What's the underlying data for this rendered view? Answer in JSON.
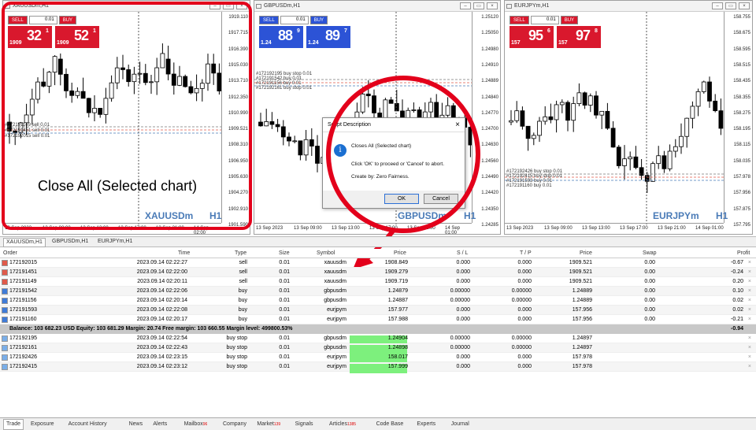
{
  "colors": {
    "sell": "#d9182d",
    "buy": "#2c53d6",
    "accent": "#e3001b",
    "bull": "#ffffff",
    "bear": "#000000",
    "pending_highlight": "#7df07d"
  },
  "charts": [
    {
      "title": "XAUUSDm,H1",
      "symbol": "XAUUSDm",
      "timeframe": "H1",
      "sell_label": "SELL",
      "buy_label": "BUY",
      "lot": "0.01",
      "sell_small": "1909",
      "sell_big": "32",
      "sell_sup": "1",
      "buy_small": "1909",
      "buy_big": "52",
      "buy_sup": "1",
      "price_ticks": [
        "1919.110",
        "1917.715",
        "1916.390",
        "1915.030",
        "1913.710",
        "1912.350",
        "1910.990",
        "1909.521",
        "1908.310",
        "1906.950",
        "1905.630",
        "1904.270",
        "1902.910",
        "1901.590"
      ],
      "time_ticks": [
        "13 Sep 2023",
        "13 Sep 08:00",
        "13 Sep 13:00",
        "13 Sep 17:00",
        "13 Sep 21:00",
        "14 Sep 02:00"
      ],
      "order_lines": [
        "#172191149 sell 0.01",
        "#172191451 sell 0.01",
        "#172192015 sell 0.01"
      ]
    },
    {
      "title": "GBPUSDm,H1",
      "symbol": "GBPUSDm",
      "timeframe": "H1",
      "sell_label": "SELL",
      "buy_label": "BUY",
      "lot": "0.01",
      "sell_small": "1.24",
      "sell_big": "88",
      "sell_sup": "9",
      "buy_small": "1.24",
      "buy_big": "89",
      "buy_sup": "7",
      "price_ticks": [
        "1.25120",
        "1.25050",
        "1.24980",
        "1.24910",
        "1.24889",
        "1.24840",
        "1.24770",
        "1.24700",
        "1.24630",
        "1.24560",
        "1.24490",
        "1.24420",
        "1.24350",
        "1.24285"
      ],
      "time_ticks": [
        "13 Sep 2023",
        "13 Sep 09:00",
        "13 Sep 13:00",
        "13 Sep 17:00",
        "13 Sep 21:00",
        "14 Sep 01:00"
      ],
      "order_lines": [
        "#172192195 buy stop 0.01",
        "#172191542 buy 0.01",
        "#172191156 buy 0.01",
        "#172192161 buy stop 0.01"
      ]
    },
    {
      "title": "EURJPYm,H1",
      "symbol": "EURJPYm",
      "timeframe": "H1",
      "sell_label": "SELL",
      "buy_label": "BUY",
      "lot": "0.01",
      "sell_small": "157",
      "sell_big": "95",
      "sell_sup": "6",
      "buy_small": "157",
      "buy_big": "97",
      "buy_sup": "8",
      "price_ticks": [
        "158.755",
        "158.675",
        "158.595",
        "158.515",
        "158.435",
        "158.355",
        "158.275",
        "158.195",
        "158.115",
        "158.035",
        "157.978",
        "157.956",
        "157.875",
        "157.795"
      ],
      "time_ticks": [
        "13 Sep 2023",
        "13 Sep 09:00",
        "13 Sep 13:00",
        "13 Sep 17:00",
        "13 Sep 21:00",
        "14 Sep 01:00"
      ],
      "order_lines": [
        "#172192426 buy stop 0.01",
        "#172192415 buy stop 0.01",
        "#172191593 buy 0.01",
        "#172191160 buy 0.01"
      ]
    }
  ],
  "overlay_caption": "Close All (Selected chart)",
  "dialog": {
    "title": "Script Description",
    "close": "×",
    "line1": "Closes All (Selected chart)",
    "line2": "Click 'OK' to proceed or 'Cancel' to abort.",
    "line3": "Create by: Zero Fairness.",
    "ok": "OK",
    "cancel": "Cancel"
  },
  "chart_tabs": [
    "XAUUSDm,H1",
    "GBPUSDm,H1",
    "EURJPYm,H1"
  ],
  "columns": {
    "order": "Order",
    "time": "Time",
    "type": "Type",
    "size": "Size",
    "symbol": "Symbol",
    "price": "Price",
    "sl": "S / L",
    "tp": "T / P",
    "price2": "Price",
    "swap": "Swap",
    "profit": "Profit"
  },
  "positions": [
    {
      "order": "172192015",
      "time": "2023.09.14 02:22:27",
      "type": "sell",
      "size": "0.01",
      "symbol": "xauusdm",
      "price": "1908.849",
      "sl": "0.000",
      "tp": "0.000",
      "cur": "1909.521",
      "swap": "0.00",
      "profit": "-0.67"
    },
    {
      "order": "172191451",
      "time": "2023.09.14 02:22:00",
      "type": "sell",
      "size": "0.01",
      "symbol": "xauusdm",
      "price": "1909.279",
      "sl": "0.000",
      "tp": "0.000",
      "cur": "1909.521",
      "swap": "0.00",
      "profit": "-0.24"
    },
    {
      "order": "172191149",
      "time": "2023.09.14 02:20:11",
      "type": "sell",
      "size": "0.01",
      "symbol": "xauusdm",
      "price": "1909.719",
      "sl": "0.000",
      "tp": "0.000",
      "cur": "1909.521",
      "swap": "0.00",
      "profit": "0.20"
    },
    {
      "order": "172191542",
      "time": "2023.09.14 02:22:06",
      "type": "buy",
      "size": "0.01",
      "symbol": "gbpusdm",
      "price": "1.24879",
      "sl": "0.00000",
      "tp": "0.00000",
      "cur": "1.24889",
      "swap": "0.00",
      "profit": "0.10"
    },
    {
      "order": "172191156",
      "time": "2023.09.14 02:20:14",
      "type": "buy",
      "size": "0.01",
      "symbol": "gbpusdm",
      "price": "1.24887",
      "sl": "0.00000",
      "tp": "0.00000",
      "cur": "1.24889",
      "swap": "0.00",
      "profit": "0.02"
    },
    {
      "order": "172191593",
      "time": "2023.09.14 02:22:08",
      "type": "buy",
      "size": "0.01",
      "symbol": "eurjpym",
      "price": "157.977",
      "sl": "0.000",
      "tp": "0.000",
      "cur": "157.956",
      "swap": "0.00",
      "profit": "0.02"
    },
    {
      "order": "172191160",
      "time": "2023.09.14 02:20:17",
      "type": "buy",
      "size": "0.01",
      "symbol": "eurjpym",
      "price": "157.988",
      "sl": "0.000",
      "tp": "0.000",
      "cur": "157.956",
      "swap": "0.00",
      "profit": "-0.21"
    }
  ],
  "balance": {
    "text": "Balance: 103 682.23 USD  Equity: 103 681.29  Margin: 20.74  Free margin: 103 660.55  Margin level: 499800.53%",
    "total": "-0.94"
  },
  "pending": [
    {
      "order": "172192195",
      "time": "2023.09.14 02:22:54",
      "type": "buy stop",
      "size": "0.01",
      "symbol": "gbpusdm",
      "price": "1.24904",
      "sl": "0.00000",
      "tp": "0.00000",
      "cur": "1.24897"
    },
    {
      "order": "172192161",
      "time": "2023.09.14 02:22:43",
      "type": "buy stop",
      "size": "0.01",
      "symbol": "gbpusdm",
      "price": "1.24898",
      "sl": "0.00000",
      "tp": "0.00000",
      "cur": "1.24897"
    },
    {
      "order": "172192426",
      "time": "2023.09.14 02:23:15",
      "type": "buy stop",
      "size": "0.01",
      "symbol": "eurjpym",
      "price": "158.017",
      "sl": "0.000",
      "tp": "0.000",
      "cur": "157.978"
    },
    {
      "order": "172192415",
      "time": "2023.09.14 02:23:12",
      "type": "buy stop",
      "size": "0.01",
      "symbol": "eurjpym",
      "price": "157.999",
      "sl": "0.000",
      "tp": "0.000",
      "cur": "157.978"
    }
  ],
  "bottom_tabs": [
    {
      "label": "Trade",
      "badge": ""
    },
    {
      "label": "Exposure",
      "badge": ""
    },
    {
      "label": "Account History",
      "badge": ""
    },
    {
      "label": "News",
      "badge": ""
    },
    {
      "label": "Alerts",
      "badge": ""
    },
    {
      "label": "Mailbox",
      "badge": "96"
    },
    {
      "label": "Company",
      "badge": ""
    },
    {
      "label": "Market",
      "badge": "139"
    },
    {
      "label": "Signals",
      "badge": ""
    },
    {
      "label": "Articles",
      "badge": "1385"
    },
    {
      "label": "Code Base",
      "badge": ""
    },
    {
      "label": "Experts",
      "badge": ""
    },
    {
      "label": "Journal",
      "badge": ""
    }
  ]
}
